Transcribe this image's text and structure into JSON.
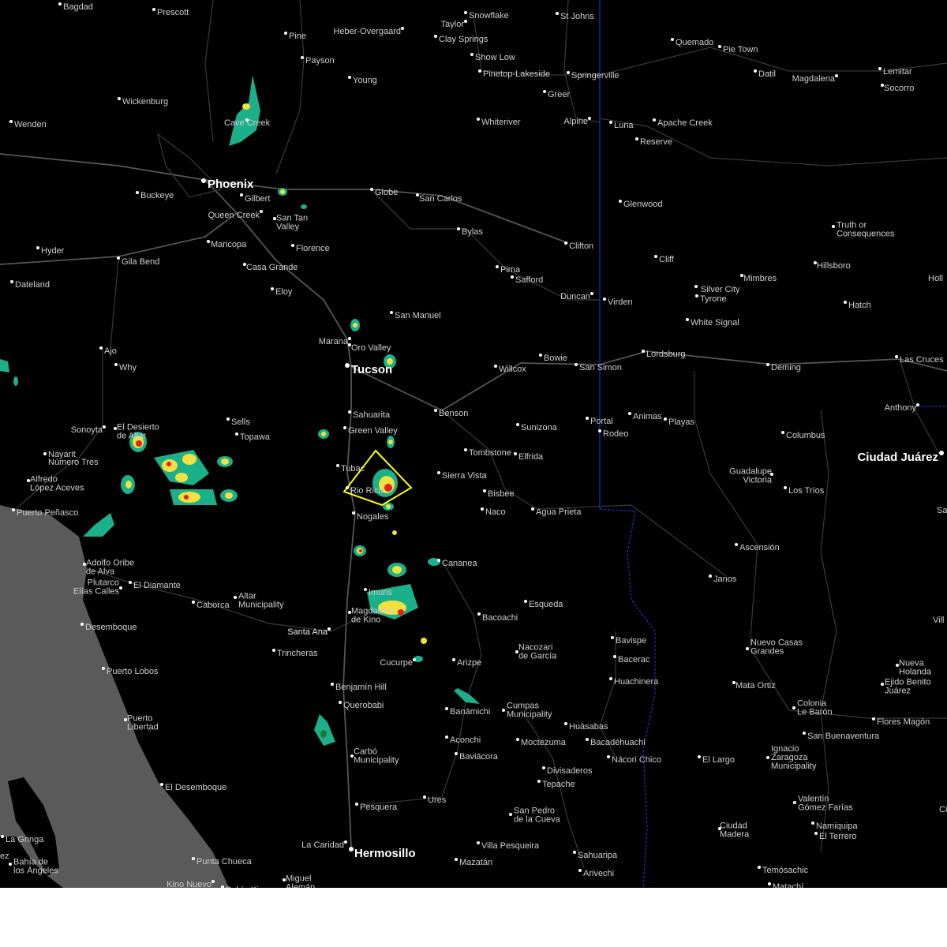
{
  "colors": {
    "land": "#000000",
    "ocean": "#5a5a5a",
    "roads": "#3a3a3a",
    "state_border": "#2a2ad0",
    "label": "#cfcfcf",
    "warning_polygon": "#ffff00",
    "radar_light": "#1bb08a",
    "radar_mid": "#f0e040",
    "radar_heavy": "#e02020"
  },
  "map": {
    "cities_major": [
      "Phoenix",
      "Tucson",
      "Hermosillo",
      "Ciudad Juárez"
    ],
    "cities": [
      "Bagdad",
      "Prescott",
      "Pine",
      "Payson",
      "Young",
      "Heber-Overgaard",
      "Taylor",
      "Snowflake",
      "St Johns",
      "Clay Springs",
      "Show Low",
      "Pinetop-Lakeside",
      "Springerville",
      "Greer",
      "Quemado",
      "Pie Town",
      "Datil",
      "Magdalena",
      "Lemitar",
      "Socorro",
      "Wickenburg",
      "Wenden",
      "Cave Creek",
      "Whiteriver",
      "Alpine",
      "Luna",
      "Apache Creek",
      "Reserve",
      "Buckeye",
      "Gilbert",
      "Globe",
      "San Carlos",
      "Queen Creek",
      "San Tan Valley",
      "Glenwood",
      "Hyder",
      "Maricopa",
      "Florence",
      "Bylas",
      "Clifton",
      "Truth or Consequences",
      "Gila Bend",
      "Casa Grande",
      "Cliff",
      "Hillsboro",
      "Dateland",
      "Eloy",
      "Pima",
      "Safford",
      "Mimbres",
      "Silver City",
      "Tyrone",
      "Duncan",
      "Virden",
      "Hatch",
      "San Manuel",
      "Marana",
      "White Signal",
      "Oro Valley",
      "Ajo",
      "Why",
      "Bowie",
      "Lordsburg",
      "Willcox",
      "San Simon",
      "Deming",
      "Las Cruces",
      "Sahuarita",
      "Sells",
      "Benson",
      "Portal",
      "Animas",
      "Playas",
      "Anthony",
      "Sonoyta",
      "El Desierto de Altar",
      "Topawa",
      "Green Valley",
      "Sunizona",
      "Rodeo",
      "Columbus",
      "Nayarit",
      "Número Tres",
      "Tombstone",
      "Elfrida",
      "Tubac",
      "Sierra Vista",
      "Guadalupe Victoria",
      "Alfredo López Aceves",
      "Rio Rico",
      "Bisbee",
      "Los Tríos",
      "Puerto Peñasco",
      "Nogales",
      "Naco",
      "Agua Prieta",
      "Ascensión",
      "Cananea",
      "Adolfo Oribe de Alva",
      "Plutarco Elías Calles",
      "El Diamante",
      "Janos",
      "Caborca",
      "Altar Municipality",
      "Imuris",
      "Esqueda",
      "Desemboque",
      "Magdalena de Kino",
      "Bacoachi",
      "Santa Ana",
      "Bavispe",
      "Trincheras",
      "Bacerac",
      "Nuevo Casas Grandes",
      "Puerto Lobos",
      "Cucurpe",
      "Arizpe",
      "Nacozari de García",
      "Huachinera",
      "Mata Ortiz",
      "Nueva Holanda",
      "Ejido Benito Juárez",
      "Benjamín Hill",
      "Querobabi",
      "Banámichi",
      "Cumpas Municipality",
      "Colonia Le Barón",
      "Puerto Libertad",
      "Huásabas",
      "Flores Magón",
      "San Buenaventura",
      "Aconchi",
      "Moctezuma",
      "Bacadéhuachi",
      "Carbó Municipality",
      "Baviácora",
      "Nácori Chico",
      "El Largo",
      "Ignacio Zaragoza Municipality",
      "Divisaderos",
      "El Desemboque",
      "Tepache",
      "Pesquera",
      "Valentín Gómez Farías",
      "Ures",
      "San Pedro de la Cueva",
      "Namiquipa",
      "El Terrero",
      "Ciudad Madera",
      "La Gringa",
      "La Caridad",
      "Villa Pesqueira",
      "Sahuaripa",
      "Bahía de los Ángeles",
      "Punta Chueca",
      "Mazatán",
      "Santa Ana",
      "Temósachic",
      "Arivechi",
      "Kino Nuevo",
      "Miguel Alemán",
      "Bahía Kino",
      "Matachí"
    ],
    "partial_labels": [
      "Holl",
      "Sa",
      "Vill",
      "Ci",
      "ez"
    ],
    "warning": {
      "type": "storm polygon"
    }
  }
}
